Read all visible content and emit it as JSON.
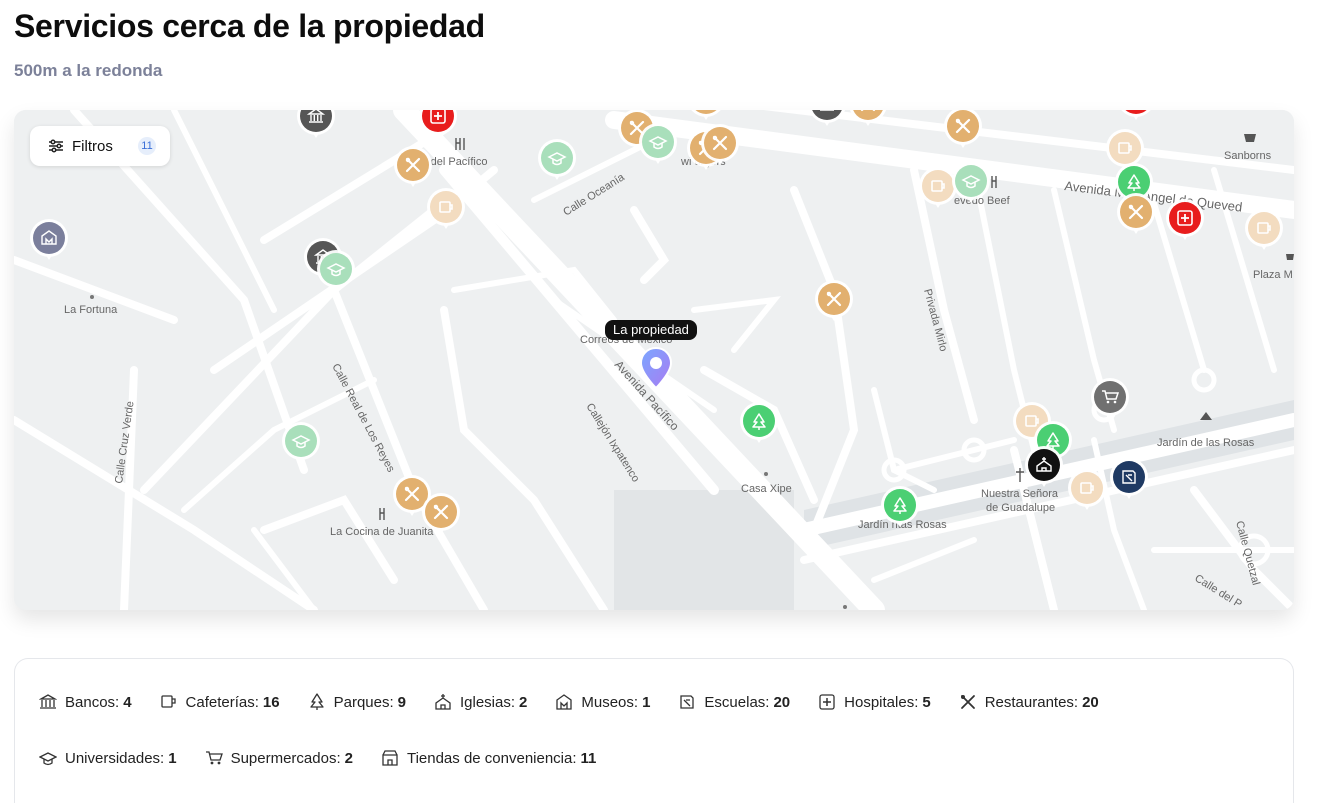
{
  "header": {
    "title": "Servicios cerca de la propiedad",
    "subtitle": "500m a la redonda"
  },
  "map": {
    "filter_label": "Filtros",
    "filter_count": "11",
    "property_label": "La propiedad",
    "labels": {
      "la_fortuna": "La Fortuna",
      "del_pacifico": "la del Pacífico",
      "calle_oceania": "Calle Oceanía",
      "burgers": "wi   urgers",
      "quevedo_beef": "  evedo Beef",
      "avenida_quevedo": "Avenida M  el Ángel de Queved",
      "sanborns": "Sanborns",
      "plaza": "Plaza M",
      "correos": "Correos de México",
      "avenida_pacifico": "Avenida Pacífico",
      "privada_mirlo": "Privada Mirlo",
      "calle_real": "Calle Real de Los Reyes",
      "calle_cruz_verde": "Calle Cruz Verde",
      "callejon": "Callejón Ixpatenco",
      "casa_xipe": "Casa Xipe",
      "jardin_rosas_1": "Jardín de las Rosas",
      "jardin_rosas_2": "Jardín  ntas Rosas",
      "nuestra_senora": "Nuestra Señora",
      "guadalupe": "de Guadalupe",
      "la_cocina": "La Cocina de Juanita",
      "calle_quetzal": "Calle Quetzal",
      "calle_de_la": "Calle del P"
    },
    "colors": {
      "restaurant": "#e2b06f",
      "cafe": "#f3dcc0",
      "park": "#4bcf73",
      "school": "#a9dfbb",
      "hospital": "#e81d1d",
      "bank": "#565656",
      "museum": "#7b7f9c",
      "church": "#111111",
      "college": "#1f3a63",
      "supermarket": "#707070",
      "property": "#5b8cf6"
    }
  },
  "summary": {
    "row1": [
      {
        "icon": "bank-icon",
        "label": "Bancos:",
        "count": "4"
      },
      {
        "icon": "cafe-icon",
        "label": "Cafeterías:",
        "count": "16"
      },
      {
        "icon": "park-icon",
        "label": "Parques:",
        "count": "9"
      },
      {
        "icon": "church-icon",
        "label": "Iglesias:",
        "count": "2"
      },
      {
        "icon": "museum-icon",
        "label": "Museos:",
        "count": "1"
      },
      {
        "icon": "school-icon",
        "label": "Escuelas:",
        "count": "20"
      },
      {
        "icon": "hospital-icon",
        "label": "Hospitales:",
        "count": "5"
      },
      {
        "icon": "restaurant-icon",
        "label": "Restaurantes:",
        "count": "20"
      }
    ],
    "row2": [
      {
        "icon": "university-icon",
        "label": "Universidades:",
        "count": "1"
      },
      {
        "icon": "cart-icon",
        "label": "Supermercados:",
        "count": "2"
      },
      {
        "icon": "store-icon",
        "label": "Tiendas de conveniencia:",
        "count": "11"
      }
    ]
  }
}
